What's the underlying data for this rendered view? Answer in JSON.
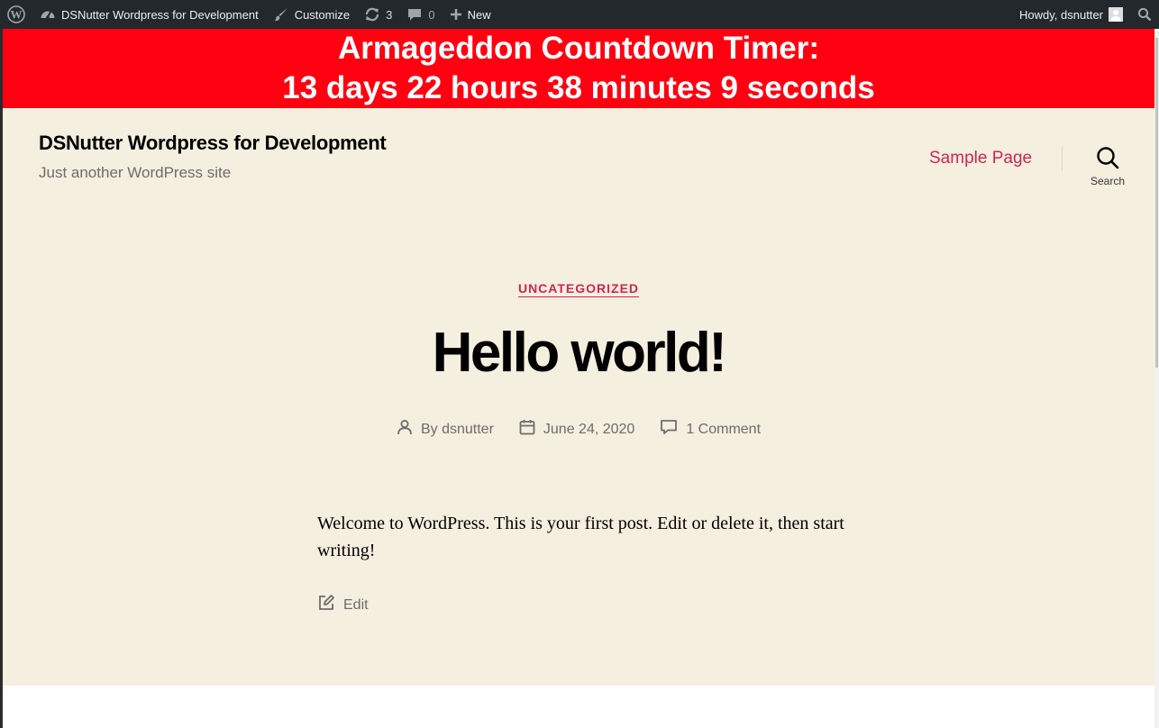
{
  "admin_bar": {
    "site_name": "DSNutter Wordpress for Development",
    "customize_label": "Customize",
    "updates_count": "3",
    "comments_count": "0",
    "new_label": "New",
    "howdy_text": "Howdy, dsnutter"
  },
  "banner": {
    "line1": "Armageddon Countdown Timer:",
    "line2": "13 days 22 hours 38 minutes 9 seconds"
  },
  "header": {
    "site_title": "DSNutter Wordpress for Development",
    "site_description": "Just another WordPress site",
    "nav_items": [
      "Sample Page"
    ],
    "search_label": "Search"
  },
  "post": {
    "category": "UNCATEGORIZED",
    "title": "Hello world!",
    "author": "By dsnutter",
    "date": "June 24, 2020",
    "comments": "1 Comment",
    "excerpt": "Welcome to WordPress. This is your first post. Edit or delete it, then start writing!",
    "edit_label": "Edit"
  },
  "colors": {
    "admin_bar": "#23282d",
    "banner": "#ff0010",
    "content_bg": "#f5efe0",
    "accent": "#cd2653",
    "meta_text": "#6d6d6d"
  }
}
